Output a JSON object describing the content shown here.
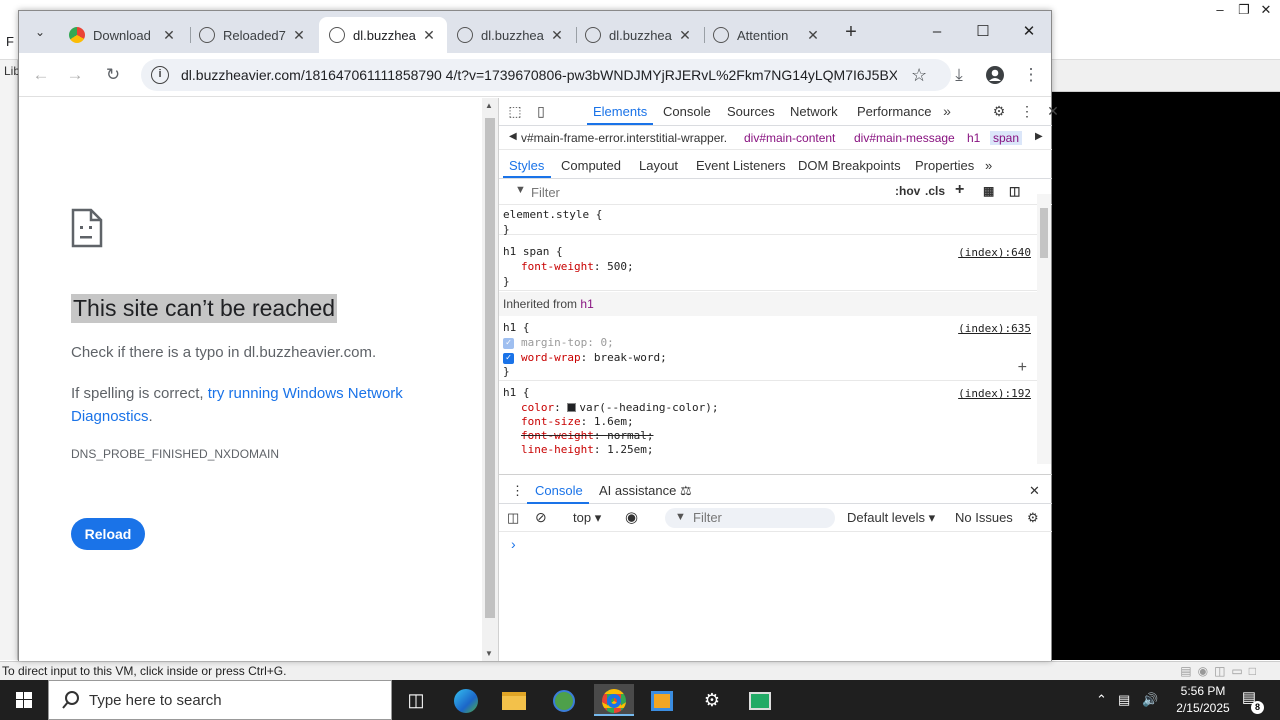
{
  "host": {
    "status_text": "To direct input to this VM, click inside or press Ctrl+G.",
    "lib_label": "Lib",
    "menu_letter": "F"
  },
  "browser": {
    "tabs": [
      {
        "label": "Download",
        "favicon": "chrome-icon",
        "active": false
      },
      {
        "label": "Reloaded7",
        "favicon": "globe-icon",
        "active": false
      },
      {
        "label": "dl.buzzhea",
        "favicon": "globe-icon",
        "active": true
      },
      {
        "label": "dl.buzzhea",
        "favicon": "globe-icon",
        "active": false
      },
      {
        "label": "dl.buzzhea",
        "favicon": "globe-icon",
        "active": false
      },
      {
        "label": "Attention",
        "favicon": "globe-icon",
        "active": false
      }
    ],
    "url": "dl.buzzheavier.com/181647061111858790 4/t?v=1739670806-pw3bWNDJMYjRJERvL%2Fkm7NG14yLQM7I6J5BXO...",
    "accent": "#1a73e8"
  },
  "page": {
    "title": "This site can’t be reached",
    "message1": "Check if there is a typo in dl.buzzheavier.com.",
    "message2_prefix": "If spelling is correct, ",
    "message2_link": "try running Windows Network Diagnostics",
    "message2_suffix": ".",
    "error_code": "DNS_PROBE_FINISHED_NXDOMAIN",
    "reload_label": "Reload"
  },
  "devtools": {
    "main_tabs": [
      "Elements",
      "Console",
      "Sources",
      "Network",
      "Performance"
    ],
    "breadcrumbs": [
      "v#main-frame-error.interstitial-wrapper.",
      "div#main-content",
      "div#main-message",
      "h1",
      "span"
    ],
    "sub_tabs": [
      "Styles",
      "Computed",
      "Layout",
      "Event Listeners",
      "DOM Breakpoints",
      "Properties"
    ],
    "filter_placeholder": "Filter",
    "hov_label": ":hov",
    "cls_label": ".cls",
    "inherited_label": "Inherited from",
    "inherited_tag": "h1",
    "rules": {
      "element_style": "element.style {",
      "close": "}",
      "r1_selector": "h1 span {",
      "r1_source": "(index):640",
      "r1_prop": "font-weight",
      "r1_val": "500;",
      "r2_selector": "h1 {",
      "r2_source": "(index):635",
      "r2_p1": "margin-top",
      "r2_v1": "0;",
      "r2_p2": "word-wrap",
      "r2_v2": "break-word;",
      "r3_selector": "h1 {",
      "r3_source": "(index):192",
      "r3_p1": "color",
      "r3_v1": "var(--heading-color);",
      "r3_p2": "font-size",
      "r3_v2": "1.6em;",
      "r3_p3": "font-weight",
      "r3_v3": "normal;",
      "r3_p4": "line-height",
      "r3_v4": "1.25em;"
    },
    "drawer_tabs": [
      "Console",
      "AI assistance"
    ],
    "console_context": "top",
    "console_filter": "Filter",
    "default_levels": "Default levels",
    "no_issues": "No Issues"
  },
  "taskbar": {
    "search_placeholder": "Type here to search",
    "time": "5:56 PM",
    "date": "2/15/2025",
    "notifications": "8"
  }
}
